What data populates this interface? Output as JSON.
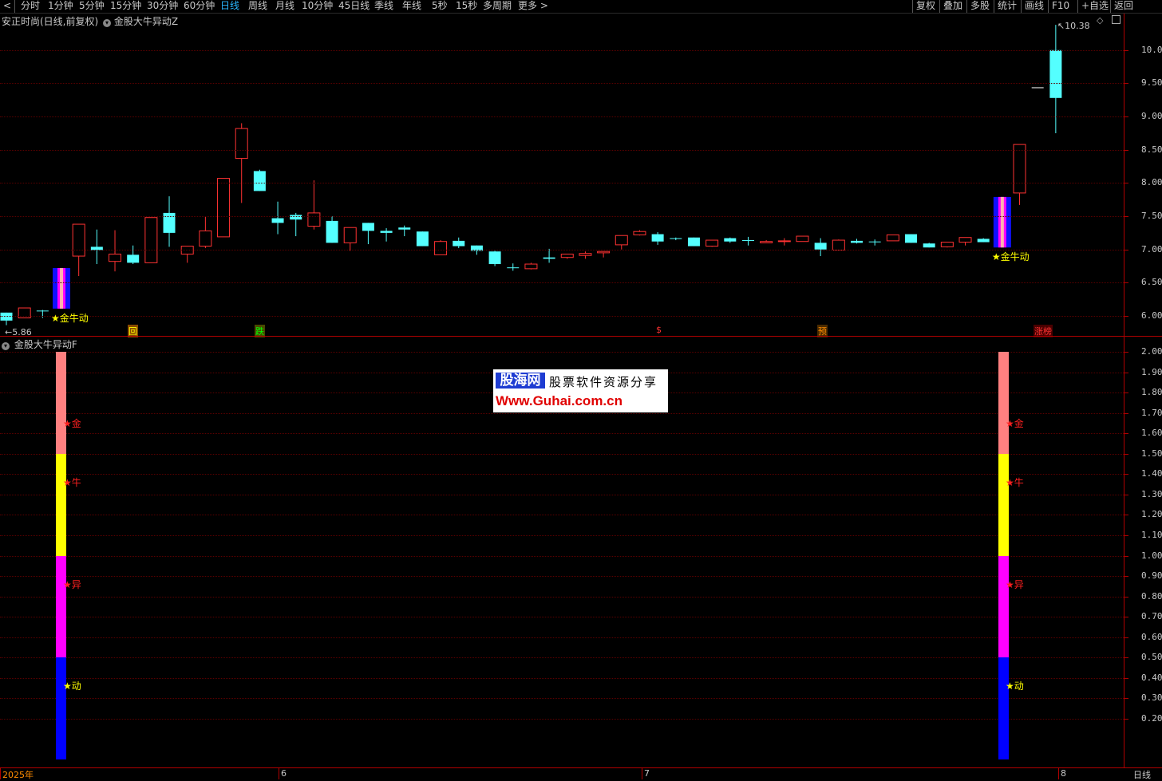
{
  "toolbar": {
    "periods": [
      "分时",
      "1分钟",
      "5分钟",
      "15分钟",
      "30分钟",
      "60分钟",
      "日线",
      "周线",
      "月线",
      "10分钟",
      "45日线",
      "季线",
      "年线",
      "5秒",
      "15秒",
      "多周期",
      "更多 >"
    ],
    "active_period": "日线",
    "right_buttons": [
      "复权",
      "叠加",
      "多股",
      "统计",
      "画线",
      "F10",
      "+自选",
      "返回"
    ]
  },
  "main_panel": {
    "stock_title": "安正时尚(日线,前复权)",
    "indicator_title": "金股大牛异动Z",
    "y_ticks": [
      "10.00",
      "9.50",
      "9.00",
      "8.50",
      "8.00",
      "7.50",
      "7.00",
      "6.50",
      "6.00"
    ],
    "max_label": "10.38",
    "min_label": "5.86",
    "signal_label": "★金牛动",
    "bottom_markers": [
      "回",
      "跌",
      "$",
      "预",
      "涨榜"
    ]
  },
  "indicator_panel": {
    "title": "金股大牛异动F",
    "y_ticks": [
      "2.00",
      "1.90",
      "1.80",
      "1.70",
      "1.60",
      "1.50",
      "1.40",
      "1.30",
      "1.20",
      "1.10",
      "1.00",
      "0.90",
      "0.80",
      "0.70",
      "0.60",
      "0.50",
      "0.40",
      "0.30",
      "0.20"
    ],
    "labels": [
      "★金",
      "★牛",
      "★异",
      "★动"
    ]
  },
  "watermark": {
    "title": "股海网",
    "subtitle": "股票软件资源分享",
    "url": "Www.Guhai.com.cn"
  },
  "time_axis": [
    "2025年",
    "6",
    "7",
    "8"
  ],
  "bottom_right_label": "日线",
  "colors": {
    "up": "#ff3232",
    "down": "#54ffff",
    "signal": "#ffff00",
    "axis": "#b00000",
    "bar_gold": "#ff8080",
    "bar_bull": "#ffff00",
    "bar_move": "#ff00ff",
    "bar_act": "#0000ff"
  },
  "chart_data": {
    "type": "candlestick",
    "ylim": [
      5.7,
      10.55
    ],
    "candles": [
      {
        "o": 6.05,
        "c": 5.93,
        "h": 6.05,
        "l": 5.86
      },
      {
        "o": 5.97,
        "c": 6.12,
        "h": 6.12,
        "l": 5.97
      },
      {
        "o": 6.08,
        "c": 6.07,
        "h": 6.09,
        "l": 5.97
      },
      {
        "o": 6.11,
        "c": 6.72,
        "h": 6.72,
        "l": 6.1,
        "signal": true
      },
      {
        "o": 6.9,
        "c": 7.38,
        "h": 7.38,
        "l": 6.6
      },
      {
        "o": 7.04,
        "c": 6.99,
        "h": 7.3,
        "l": 6.78
      },
      {
        "o": 6.82,
        "c": 6.93,
        "h": 7.29,
        "l": 6.67
      },
      {
        "o": 6.92,
        "c": 6.8,
        "h": 7.06,
        "l": 6.78
      },
      {
        "o": 6.8,
        "c": 7.48,
        "h": 7.48,
        "l": 6.8
      },
      {
        "o": 7.55,
        "c": 7.25,
        "h": 7.8,
        "l": 7.04
      },
      {
        "o": 6.93,
        "c": 7.05,
        "h": 7.05,
        "l": 6.8
      },
      {
        "o": 7.05,
        "c": 7.28,
        "h": 7.49,
        "l": 7.02
      },
      {
        "o": 7.19,
        "c": 8.07,
        "h": 8.07,
        "l": 7.19
      },
      {
        "o": 8.37,
        "c": 8.82,
        "h": 8.9,
        "l": 7.7
      },
      {
        "o": 8.18,
        "c": 7.88,
        "h": 8.2,
        "l": 7.88
      },
      {
        "o": 7.47,
        "c": 7.4,
        "h": 7.72,
        "l": 7.23
      },
      {
        "o": 7.52,
        "c": 7.45,
        "h": 7.55,
        "l": 7.2
      },
      {
        "o": 7.35,
        "c": 7.55,
        "h": 8.04,
        "l": 7.3
      },
      {
        "o": 7.43,
        "c": 7.1,
        "h": 7.5,
        "l": 7.1
      },
      {
        "o": 7.1,
        "c": 7.33,
        "h": 7.33,
        "l": 6.98
      },
      {
        "o": 7.4,
        "c": 7.28,
        "h": 7.4,
        "l": 7.08
      },
      {
        "o": 7.28,
        "c": 7.25,
        "h": 7.32,
        "l": 7.12
      },
      {
        "o": 7.33,
        "c": 7.3,
        "h": 7.36,
        "l": 7.2
      },
      {
        "o": 7.27,
        "c": 7.05,
        "h": 7.27,
        "l": 7.05
      },
      {
        "o": 6.92,
        "c": 7.12,
        "h": 7.14,
        "l": 6.92
      },
      {
        "o": 7.13,
        "c": 7.05,
        "h": 7.18,
        "l": 7.02
      },
      {
        "o": 7.06,
        "c": 6.98,
        "h": 7.06,
        "l": 6.92
      },
      {
        "o": 6.97,
        "c": 6.78,
        "h": 6.98,
        "l": 6.75
      },
      {
        "o": 6.73,
        "c": 6.72,
        "h": 6.79,
        "l": 6.68
      },
      {
        "o": 6.71,
        "c": 6.78,
        "h": 6.8,
        "l": 6.7
      },
      {
        "o": 6.88,
        "c": 6.86,
        "h": 7.01,
        "l": 6.8
      },
      {
        "o": 6.88,
        "c": 6.93,
        "h": 6.93,
        "l": 6.86
      },
      {
        "o": 6.91,
        "c": 6.94,
        "h": 6.97,
        "l": 6.86
      },
      {
        "o": 6.95,
        "c": 6.97,
        "h": 6.97,
        "l": 6.88
      },
      {
        "o": 7.07,
        "c": 7.21,
        "h": 7.21,
        "l": 7.0
      },
      {
        "o": 7.22,
        "c": 7.27,
        "h": 7.29,
        "l": 7.21
      },
      {
        "o": 7.23,
        "c": 7.12,
        "h": 7.26,
        "l": 7.07
      },
      {
        "o": 7.17,
        "c": 7.16,
        "h": 7.18,
        "l": 7.14
      },
      {
        "o": 7.18,
        "c": 7.05,
        "h": 7.18,
        "l": 7.05
      },
      {
        "o": 7.05,
        "c": 7.14,
        "h": 7.14,
        "l": 7.04
      },
      {
        "o": 7.17,
        "c": 7.12,
        "h": 7.18,
        "l": 7.1
      },
      {
        "o": 7.14,
        "c": 7.13,
        "h": 7.19,
        "l": 7.06
      },
      {
        "o": 7.1,
        "c": 7.12,
        "h": 7.14,
        "l": 7.1
      },
      {
        "o": 7.12,
        "c": 7.13,
        "h": 7.17,
        "l": 7.06
      },
      {
        "o": 7.12,
        "c": 7.2,
        "h": 7.2,
        "l": 7.12
      },
      {
        "o": 7.1,
        "c": 7.0,
        "h": 7.17,
        "l": 6.9
      },
      {
        "o": 6.99,
        "c": 7.14,
        "h": 7.15,
        "l": 6.99
      },
      {
        "o": 7.13,
        "c": 7.1,
        "h": 7.16,
        "l": 7.09
      },
      {
        "o": 7.12,
        "c": 7.11,
        "h": 7.15,
        "l": 7.06
      },
      {
        "o": 7.13,
        "c": 7.22,
        "h": 7.22,
        "l": 7.13
      },
      {
        "o": 7.23,
        "c": 7.1,
        "h": 7.23,
        "l": 7.1
      },
      {
        "o": 7.09,
        "c": 7.03,
        "h": 7.1,
        "l": 7.03
      },
      {
        "o": 7.04,
        "c": 7.11,
        "h": 7.11,
        "l": 7.03
      },
      {
        "o": 7.11,
        "c": 7.18,
        "h": 7.18,
        "l": 7.06
      },
      {
        "o": 7.16,
        "c": 7.11,
        "h": 7.17,
        "l": 7.11
      },
      {
        "o": 7.03,
        "c": 7.79,
        "h": 7.8,
        "l": 7.03,
        "signal": true
      },
      {
        "o": 7.85,
        "c": 8.58,
        "h": 8.58,
        "l": 7.67
      },
      {
        "o": 9.44,
        "c": 9.44,
        "h": 9.44,
        "l": 9.44
      },
      {
        "o": 10.0,
        "c": 9.28,
        "h": 10.38,
        "l": 8.75
      }
    ]
  }
}
